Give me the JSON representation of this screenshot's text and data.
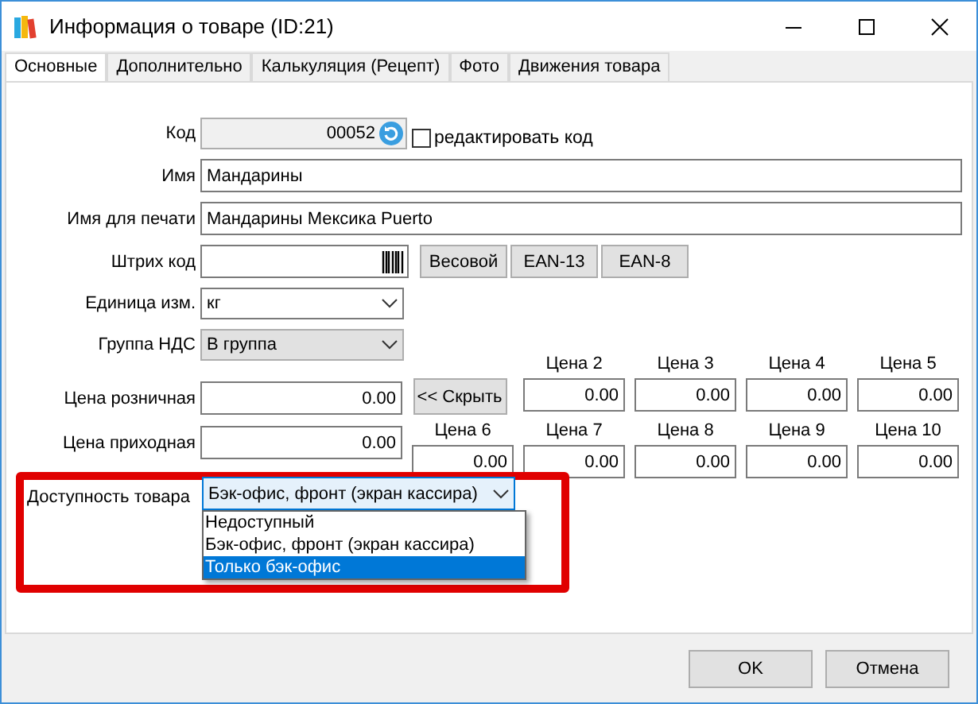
{
  "window": {
    "title": "Информация о товаре (ID:21)"
  },
  "tabs": [
    {
      "label": "Основные",
      "selected": true
    },
    {
      "label": "Дополнительно",
      "selected": false
    },
    {
      "label": "Калькуляция (Рецепт)",
      "selected": false
    },
    {
      "label": "Фото",
      "selected": false
    },
    {
      "label": "Движения товара",
      "selected": false
    }
  ],
  "code": {
    "label": "Код",
    "value": "00052",
    "edit_checkbox": {
      "label": "редактировать код",
      "checked": false
    }
  },
  "name": {
    "label": "Имя",
    "value": "Мандарины"
  },
  "print_name": {
    "label": "Имя для печати",
    "value": "Мандарины Мексика Puerto"
  },
  "barcode": {
    "label": "Штрих код",
    "buttons": [
      "Весовой",
      "EAN-13",
      "EAN-8"
    ]
  },
  "unit": {
    "label": "Единица изм.",
    "value": "кг"
  },
  "vat_group": {
    "label": "Группа НДС",
    "value": "В группа"
  },
  "retail_price": {
    "label": "Цена розничная",
    "value": "0.00"
  },
  "purchase_price": {
    "label": "Цена приходная",
    "value": "0.00"
  },
  "hide_button": "<< Скрыть",
  "prices": [
    {
      "label": "Цена 2",
      "value": "0.00"
    },
    {
      "label": "Цена 3",
      "value": "0.00"
    },
    {
      "label": "Цена 4",
      "value": "0.00"
    },
    {
      "label": "Цена 5",
      "value": "0.00"
    },
    {
      "label": "Цена 6",
      "value": "0.00"
    },
    {
      "label": "Цена 7",
      "value": "0.00"
    },
    {
      "label": "Цена 8",
      "value": "0.00"
    },
    {
      "label": "Цена 9",
      "value": "0.00"
    },
    {
      "label": "Цена 10",
      "value": "0.00"
    }
  ],
  "availability": {
    "label": "Доступность товара",
    "value": "Бэк-офис, фронт (экран кассира)",
    "expanded": true,
    "options": [
      {
        "label": "Недоступный",
        "highlighted": false
      },
      {
        "label": "Бэк-офис, фронт (экран кассира)",
        "highlighted": false
      },
      {
        "label": "Только бэк-офис",
        "highlighted": true
      }
    ]
  },
  "buttons": [
    "OK",
    "Отмена"
  ]
}
